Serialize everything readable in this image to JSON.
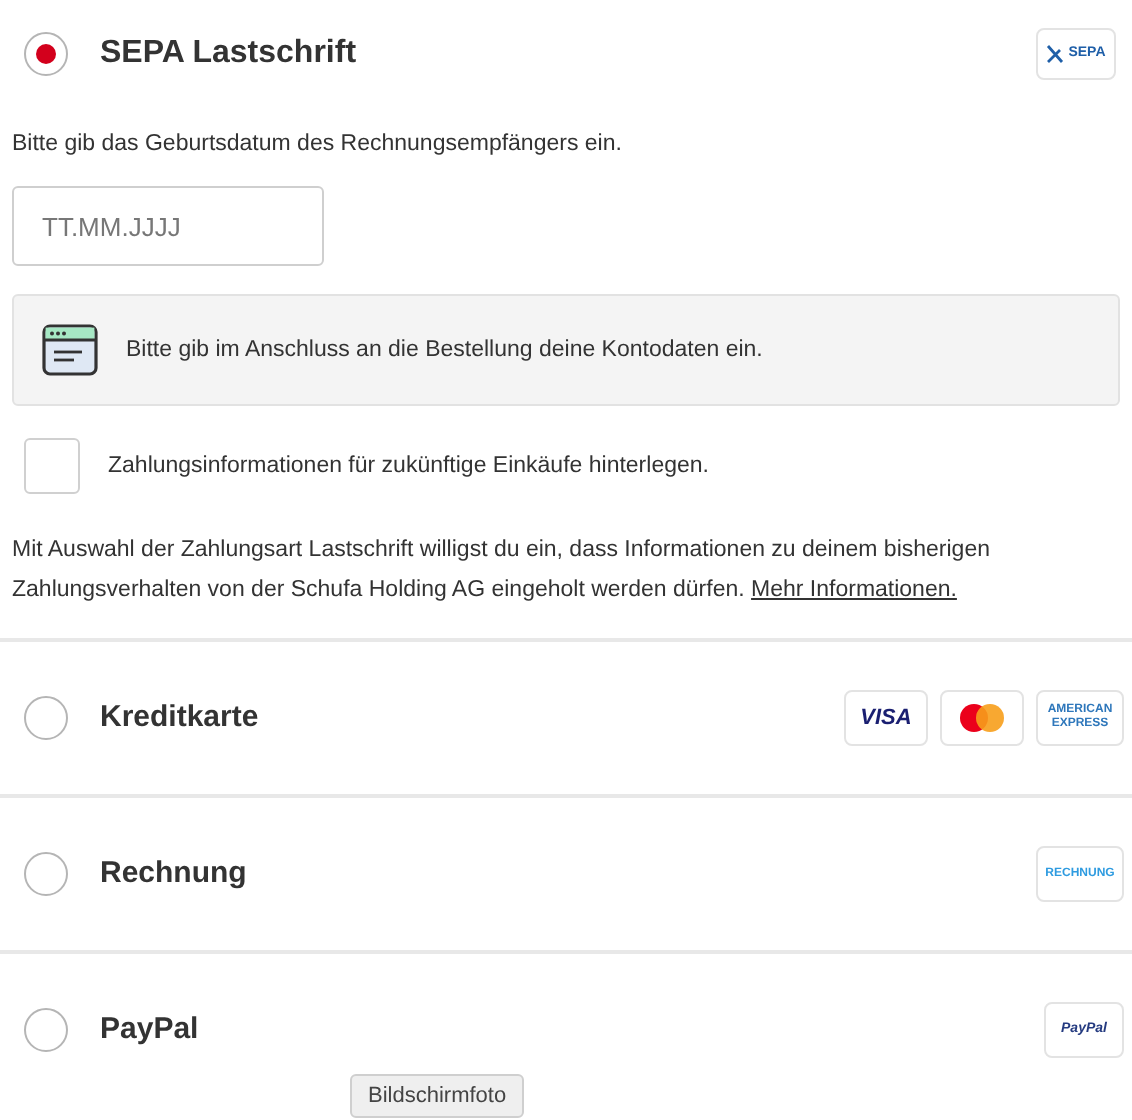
{
  "selected_method": {
    "label": "SEPA Lastschrift",
    "selected": true,
    "logo": "SEPA"
  },
  "birthdate": {
    "prompt": "Bitte gib das Geburtsdatum des Rechnungsempfängers ein.",
    "placeholder": "TT.MM.JJJJ"
  },
  "info": {
    "text": "Bitte gib im Anschluss an die Bestellung deine Kontodaten ein."
  },
  "save_option": {
    "label": "Zahlungsinformationen für zukünftige Einkäufe hinterlegen.",
    "checked": false
  },
  "consent": {
    "text": "Mit Auswahl der Zahlungsart Lastschrift willigst du ein, dass Informationen zu deinem bisherigen Zahlungsverhalten von der Schufa Holding AG eingeholt werden dürfen.",
    "link": "Mehr Informationen."
  },
  "methods": [
    {
      "label": "Kreditkarte",
      "selected": false,
      "logos": [
        {
          "kind": "visa",
          "text": "VISA"
        },
        {
          "kind": "mastercard"
        },
        {
          "kind": "amex",
          "text": "AMERICAN EXPRESS"
        }
      ]
    },
    {
      "label": "Rechnung",
      "selected": false,
      "logos": [
        {
          "kind": "invoice",
          "text": "RECHNUNG"
        }
      ]
    },
    {
      "label": "PayPal",
      "selected": false,
      "logos": [
        {
          "kind": "paypal",
          "text": "PayPal"
        }
      ]
    }
  ],
  "tooltip": {
    "text": "Bildschirmfoto"
  }
}
